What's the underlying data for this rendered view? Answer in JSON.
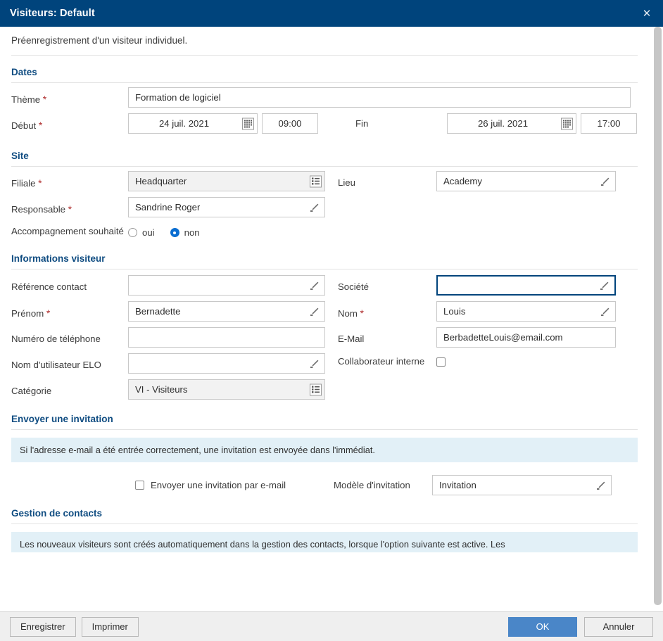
{
  "window": {
    "title": "Visiteurs: Default",
    "close_icon": "close-icon",
    "intro": "Préenregistrement d'un visiteur individuel."
  },
  "sections": {
    "dates": {
      "heading": "Dates",
      "theme": {
        "label": "Thème",
        "required": "*",
        "value": "Formation de logiciel"
      },
      "debut": {
        "label": "Début",
        "required": "*",
        "date": "24 juil. 2021",
        "time": "09:00",
        "picker_icon": "calendar-icon"
      },
      "fin": {
        "label": "Fin",
        "date": "26 juil. 2021",
        "time": "17:00",
        "picker_icon": "calendar-icon"
      }
    },
    "site": {
      "heading": "Site",
      "filiale": {
        "label": "Filiale",
        "required": "*",
        "value": "Headquarter",
        "icon": "list-icon"
      },
      "lieu": {
        "label": "Lieu",
        "value": "Academy",
        "icon": "pencil-icon"
      },
      "responsable": {
        "label": "Responsable",
        "required": "*",
        "value": "Sandrine Roger",
        "icon": "pencil-icon"
      },
      "accompagnement": {
        "label": "Accompagnement souhaité",
        "options": [
          {
            "label": "oui",
            "selected": false
          },
          {
            "label": "non",
            "selected": true
          }
        ]
      }
    },
    "visiteur": {
      "heading": "Informations visiteur",
      "reference": {
        "label": "Référence contact",
        "value": "",
        "icon": "pencil-icon"
      },
      "societe": {
        "label": "Société",
        "value": "",
        "icon": "pencil-icon",
        "focused": true
      },
      "prenom": {
        "label": "Prénom",
        "required": "*",
        "value": "Bernadette",
        "icon": "pencil-icon"
      },
      "nom": {
        "label": "Nom",
        "required": "*",
        "value": "Louis",
        "icon": "pencil-icon"
      },
      "telephone": {
        "label": "Numéro de téléphone",
        "value": ""
      },
      "email": {
        "label": "E-Mail",
        "value": "BerbadetteLouis@email.com"
      },
      "elo_user": {
        "label": "Nom d'utilisateur ELO",
        "value": "",
        "icon": "pencil-icon"
      },
      "collaborateur": {
        "label": "Collaborateur interne",
        "checked": false
      },
      "categorie": {
        "label": "Catégorie",
        "value": "VI - Visiteurs",
        "icon": "list-icon"
      }
    },
    "invitation": {
      "heading": "Envoyer une invitation",
      "info": "Si l'adresse e-mail a été entrée correctement, une invitation est envoyée dans l'immédiat.",
      "send_checkbox": {
        "label": "Envoyer une invitation par e-mail",
        "checked": false
      },
      "modele": {
        "label": "Modèle d'invitation",
        "value": "Invitation",
        "icon": "pencil-icon"
      }
    },
    "contacts": {
      "heading": "Gestion de contacts",
      "info": "Les nouveaux visiteurs sont créés automatiquement dans la gestion des contacts, lorsque l'option suivante est active. Les"
    }
  },
  "footer": {
    "save": "Enregistrer",
    "print": "Imprimer",
    "ok": "OK",
    "cancel": "Annuler"
  },
  "colors": {
    "titlebar": "#00447c",
    "accent": "#0f4c81",
    "primary_button": "#4a86c8",
    "info_banner": "#e2f0f7",
    "required_star": "#b03030",
    "radio_on": "#0a6ed1"
  }
}
